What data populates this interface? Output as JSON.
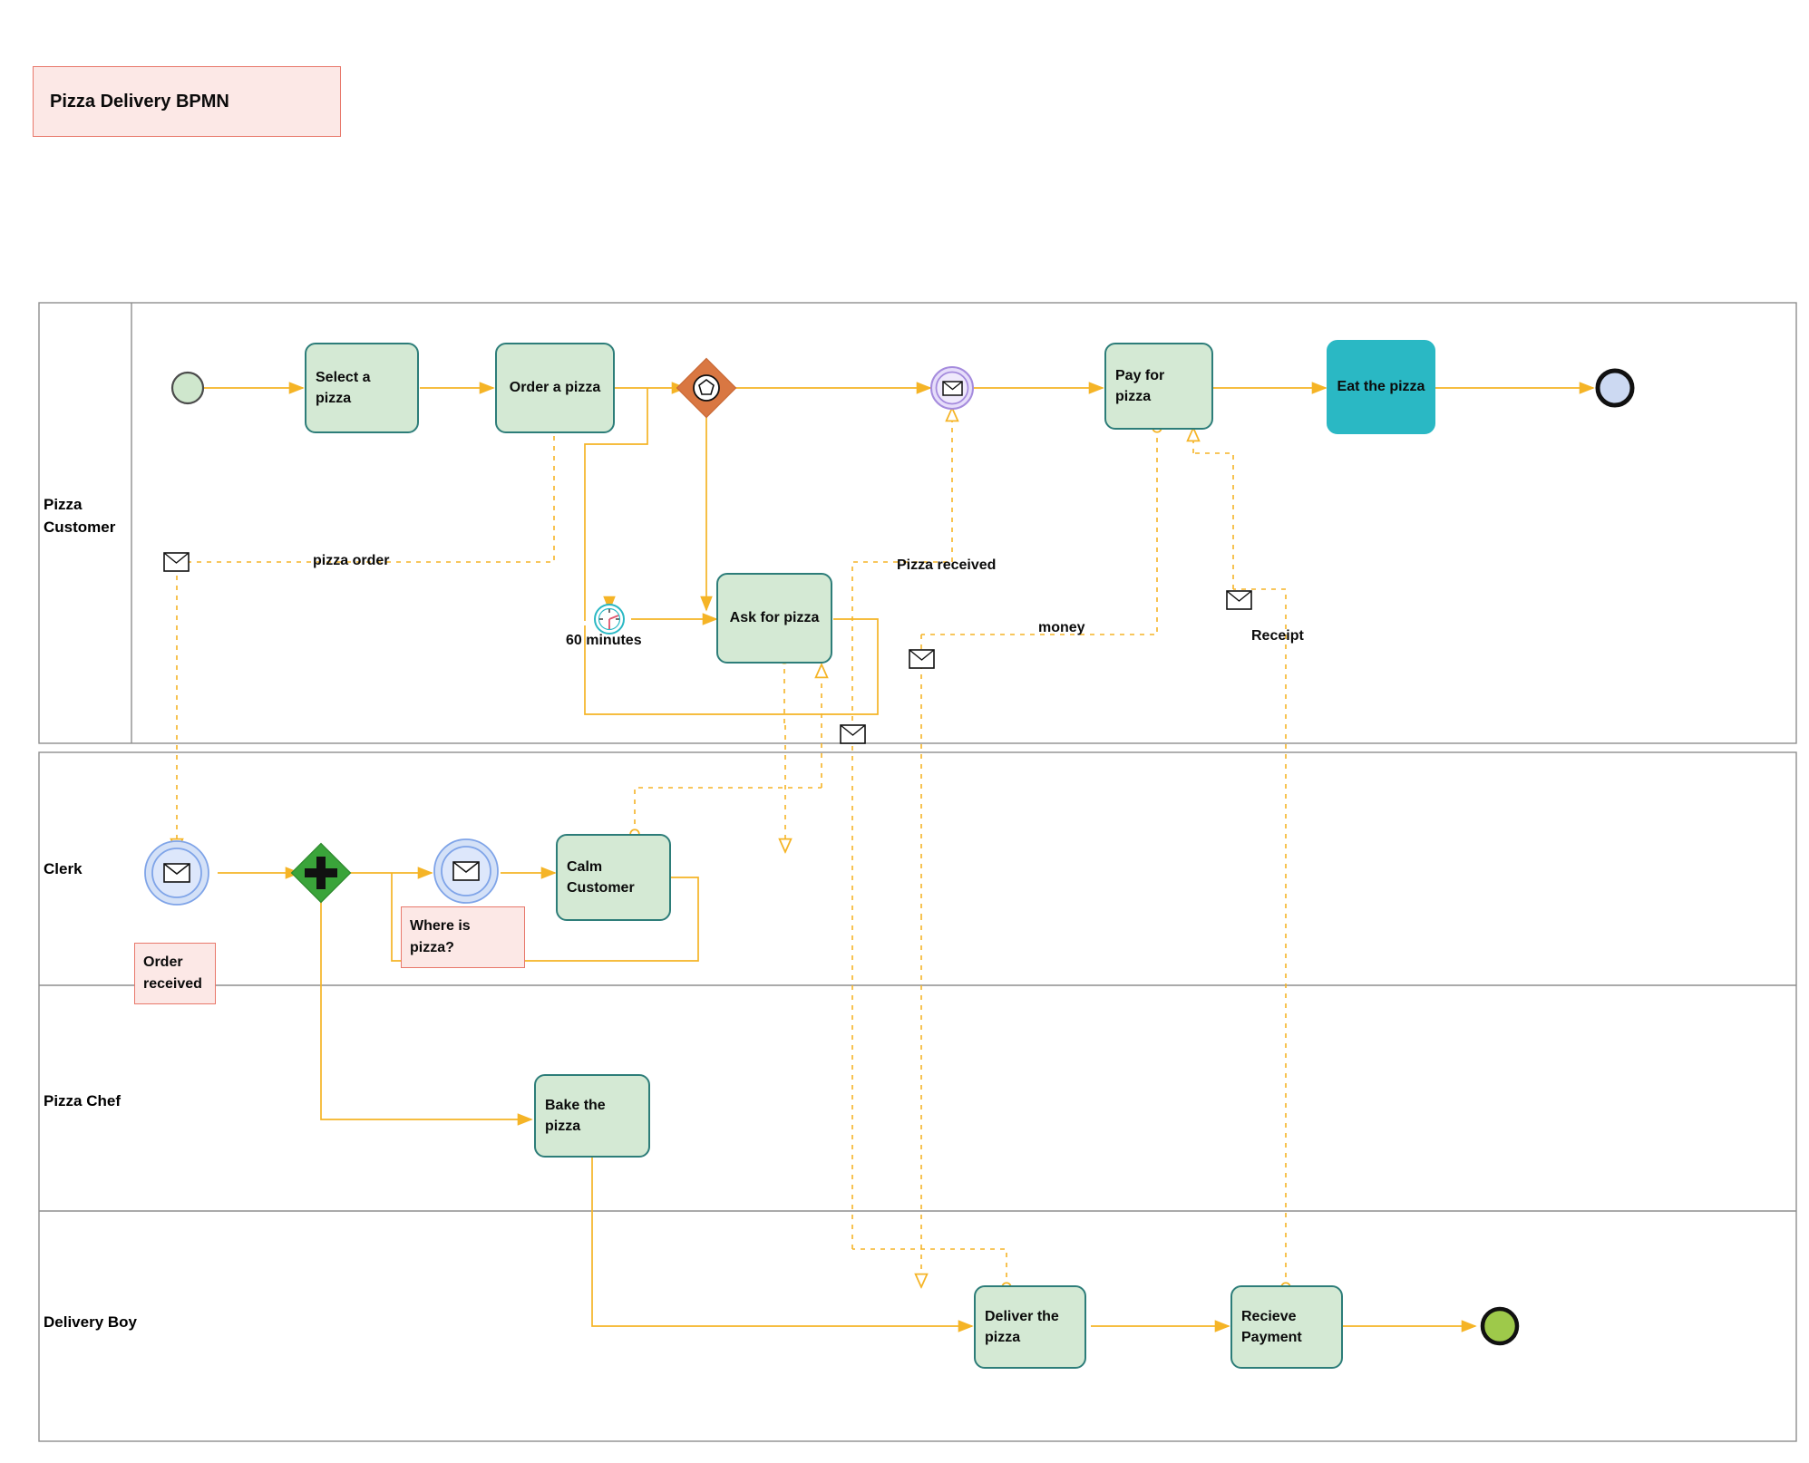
{
  "title": {
    "text": "Pizza Delivery BPMN"
  },
  "pools": [
    {
      "id": "customer",
      "name": "Pizza\nCustomer"
    },
    {
      "id": "restaurant",
      "lanes": [
        {
          "id": "clerk",
          "name": "Clerk"
        },
        {
          "id": "chef",
          "name": "Pizza Chef"
        },
        {
          "id": "delivery",
          "name": "Delivery Boy"
        }
      ]
    }
  ],
  "tasks": {
    "select_pizza": "Select a pizza",
    "order_pizza": "Order a pizza",
    "ask_for_pizza": "Ask for pizza",
    "pay_for_pizza": "Pay for pizza",
    "eat_the_pizza": "Eat the pizza",
    "calm_customer": "Calm\nCustomer",
    "bake_the_pizza": "Bake the\npizza",
    "deliver_the_pizza": "Deliver the\npizza",
    "recieve_payment": "Recieve\nPayment"
  },
  "events": {
    "customer_start": "",
    "customer_end": "",
    "pizza_received_msg_event": "",
    "timer_60min": "60 minutes",
    "clerk_order_start": "",
    "clerk_where_start": "",
    "delivery_end": ""
  },
  "gateways": {
    "event_gateway": "",
    "parallel_gateway": ""
  },
  "annotations": {
    "order_received": "Order\nreceived",
    "where_is_pizza": "Where is\npizza?"
  },
  "message_flows": {
    "pizza_order": "pizza order",
    "pizza_received": "Pizza received",
    "money": "money",
    "receipt": "Receipt"
  },
  "colors": {
    "task_fill": "#d4e9d4",
    "task_stroke": "#2d7d79",
    "eat_pizza_fill": "#2ab8c4",
    "flow_line": "#f5b426",
    "note_fill": "#fce8e6",
    "note_stroke": "#e8786b",
    "gateway_event_fill": "#d97742",
    "gateway_parallel_fill": "#3aa43a",
    "msg_event_blue": "#d4e1f7",
    "msg_event_purple": "#e6ddfa",
    "end_green": "#9ec94a",
    "end_blue": "#ccd9f2",
    "start_green": "#cfe7cd",
    "lane_stroke": "#8e8e8e",
    "timer_stroke": "#2ab8c4"
  }
}
